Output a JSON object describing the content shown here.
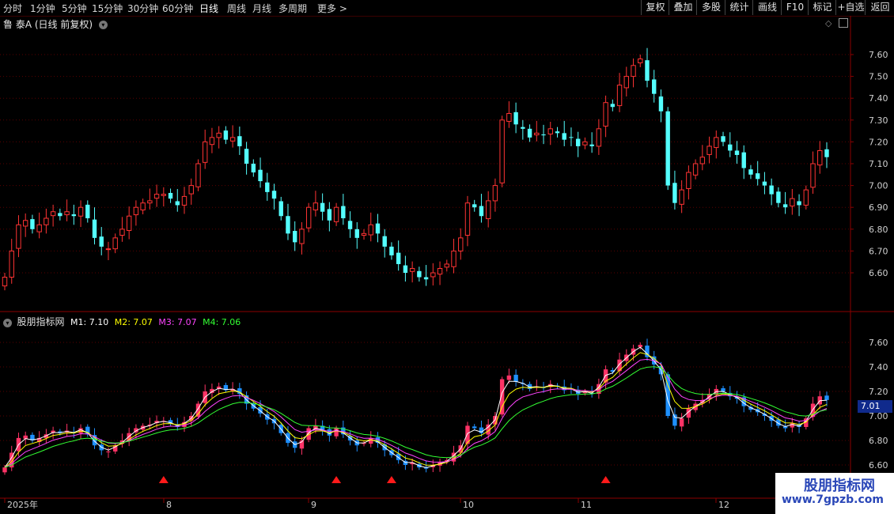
{
  "toolbar": {
    "periods": [
      "分时",
      "1分钟",
      "5分钟",
      "15分钟",
      "30分钟",
      "60分钟",
      "日线",
      "周线",
      "月线",
      "多周期",
      "更多 >"
    ],
    "active": "日线",
    "right_buttons": [
      "复权",
      "叠加",
      "多股",
      "统计",
      "画线",
      "F10",
      "标记",
      "+自选",
      "返回"
    ]
  },
  "main_header": {
    "stock": "鲁 泰A",
    "mode": "(日线 前复权)"
  },
  "indicator_header": {
    "name": "股朋指标网",
    "m1": "M1: 7.10",
    "m2": "M2: 7.07",
    "m3": "M3: 7.07",
    "m4": "M4: 7.06"
  },
  "price_badge": "7.01",
  "watermark": {
    "name": "股朋指标网",
    "url": "www.7gpzb.com"
  },
  "colors": {
    "up": "#ff3333",
    "down": "#54ffff",
    "ind_up": "#ff3366",
    "ind_down": "#1e90ff",
    "m1": "#ffffff",
    "m2": "#ffff00",
    "m3": "#ff44ff",
    "m4": "#33ff33",
    "grid": "#5a0000"
  },
  "chart_data": {
    "type": "candlestick",
    "main_y_ticks": [
      "7.60",
      "7.50",
      "7.40",
      "7.30",
      "7.20",
      "7.10",
      "7.00",
      "6.90",
      "6.80",
      "6.70",
      "6.60"
    ],
    "ind_y_ticks": [
      "7.60",
      "7.40",
      "7.20",
      "7.00",
      "6.80",
      "6.60"
    ],
    "x_labels": [
      "2025年",
      "8",
      "9",
      "10",
      "11",
      "12"
    ],
    "x_label_dates": [
      "2025-07-01",
      "2025-08-01",
      "2025-09-01",
      "2025-10-09",
      "2025-11-03",
      "2025-12-01"
    ],
    "signal_dates": [
      "2025-08-01",
      "2025-09-05",
      "2025-09-17",
      "2025-11-07"
    ],
    "closes": [
      6.58,
      6.7,
      6.82,
      6.84,
      6.8,
      6.82,
      6.85,
      6.88,
      6.86,
      6.88,
      6.86,
      6.9,
      6.85,
      6.76,
      6.72,
      6.71,
      6.76,
      6.8,
      6.86,
      6.9,
      6.92,
      6.93,
      6.96,
      6.96,
      6.94,
      6.91,
      6.95,
      7.0,
      7.1,
      7.2,
      7.22,
      7.24,
      7.21,
      7.22,
      7.18,
      7.1,
      7.06,
      7.02,
      6.97,
      6.94,
      6.86,
      6.78,
      6.74,
      6.8,
      6.9,
      6.92,
      6.88,
      6.84,
      6.9,
      6.85,
      6.8,
      6.76,
      6.78,
      6.82,
      6.78,
      6.72,
      6.68,
      6.64,
      6.6,
      6.62,
      6.58,
      6.57,
      6.6,
      6.62,
      6.64,
      6.7,
      6.76,
      6.92,
      6.9,
      6.86,
      6.93,
      7.0,
      7.3,
      7.33,
      7.28,
      7.26,
      7.22,
      7.24,
      7.23,
      7.26,
      7.24,
      7.21,
      7.22,
      7.18,
      7.2,
      7.18,
      7.26,
      7.38,
      7.36,
      7.46,
      7.5,
      7.55,
      7.58,
      7.48,
      7.42,
      7.34,
      7.0,
      6.92,
      6.98,
      7.06,
      7.1,
      7.13,
      7.18,
      7.22,
      7.2,
      7.16,
      7.14,
      7.08,
      7.05,
      7.03,
      7.0,
      6.96,
      6.92,
      6.9,
      6.94,
      6.91,
      6.98,
      7.1,
      7.16,
      7.13
    ]
  }
}
